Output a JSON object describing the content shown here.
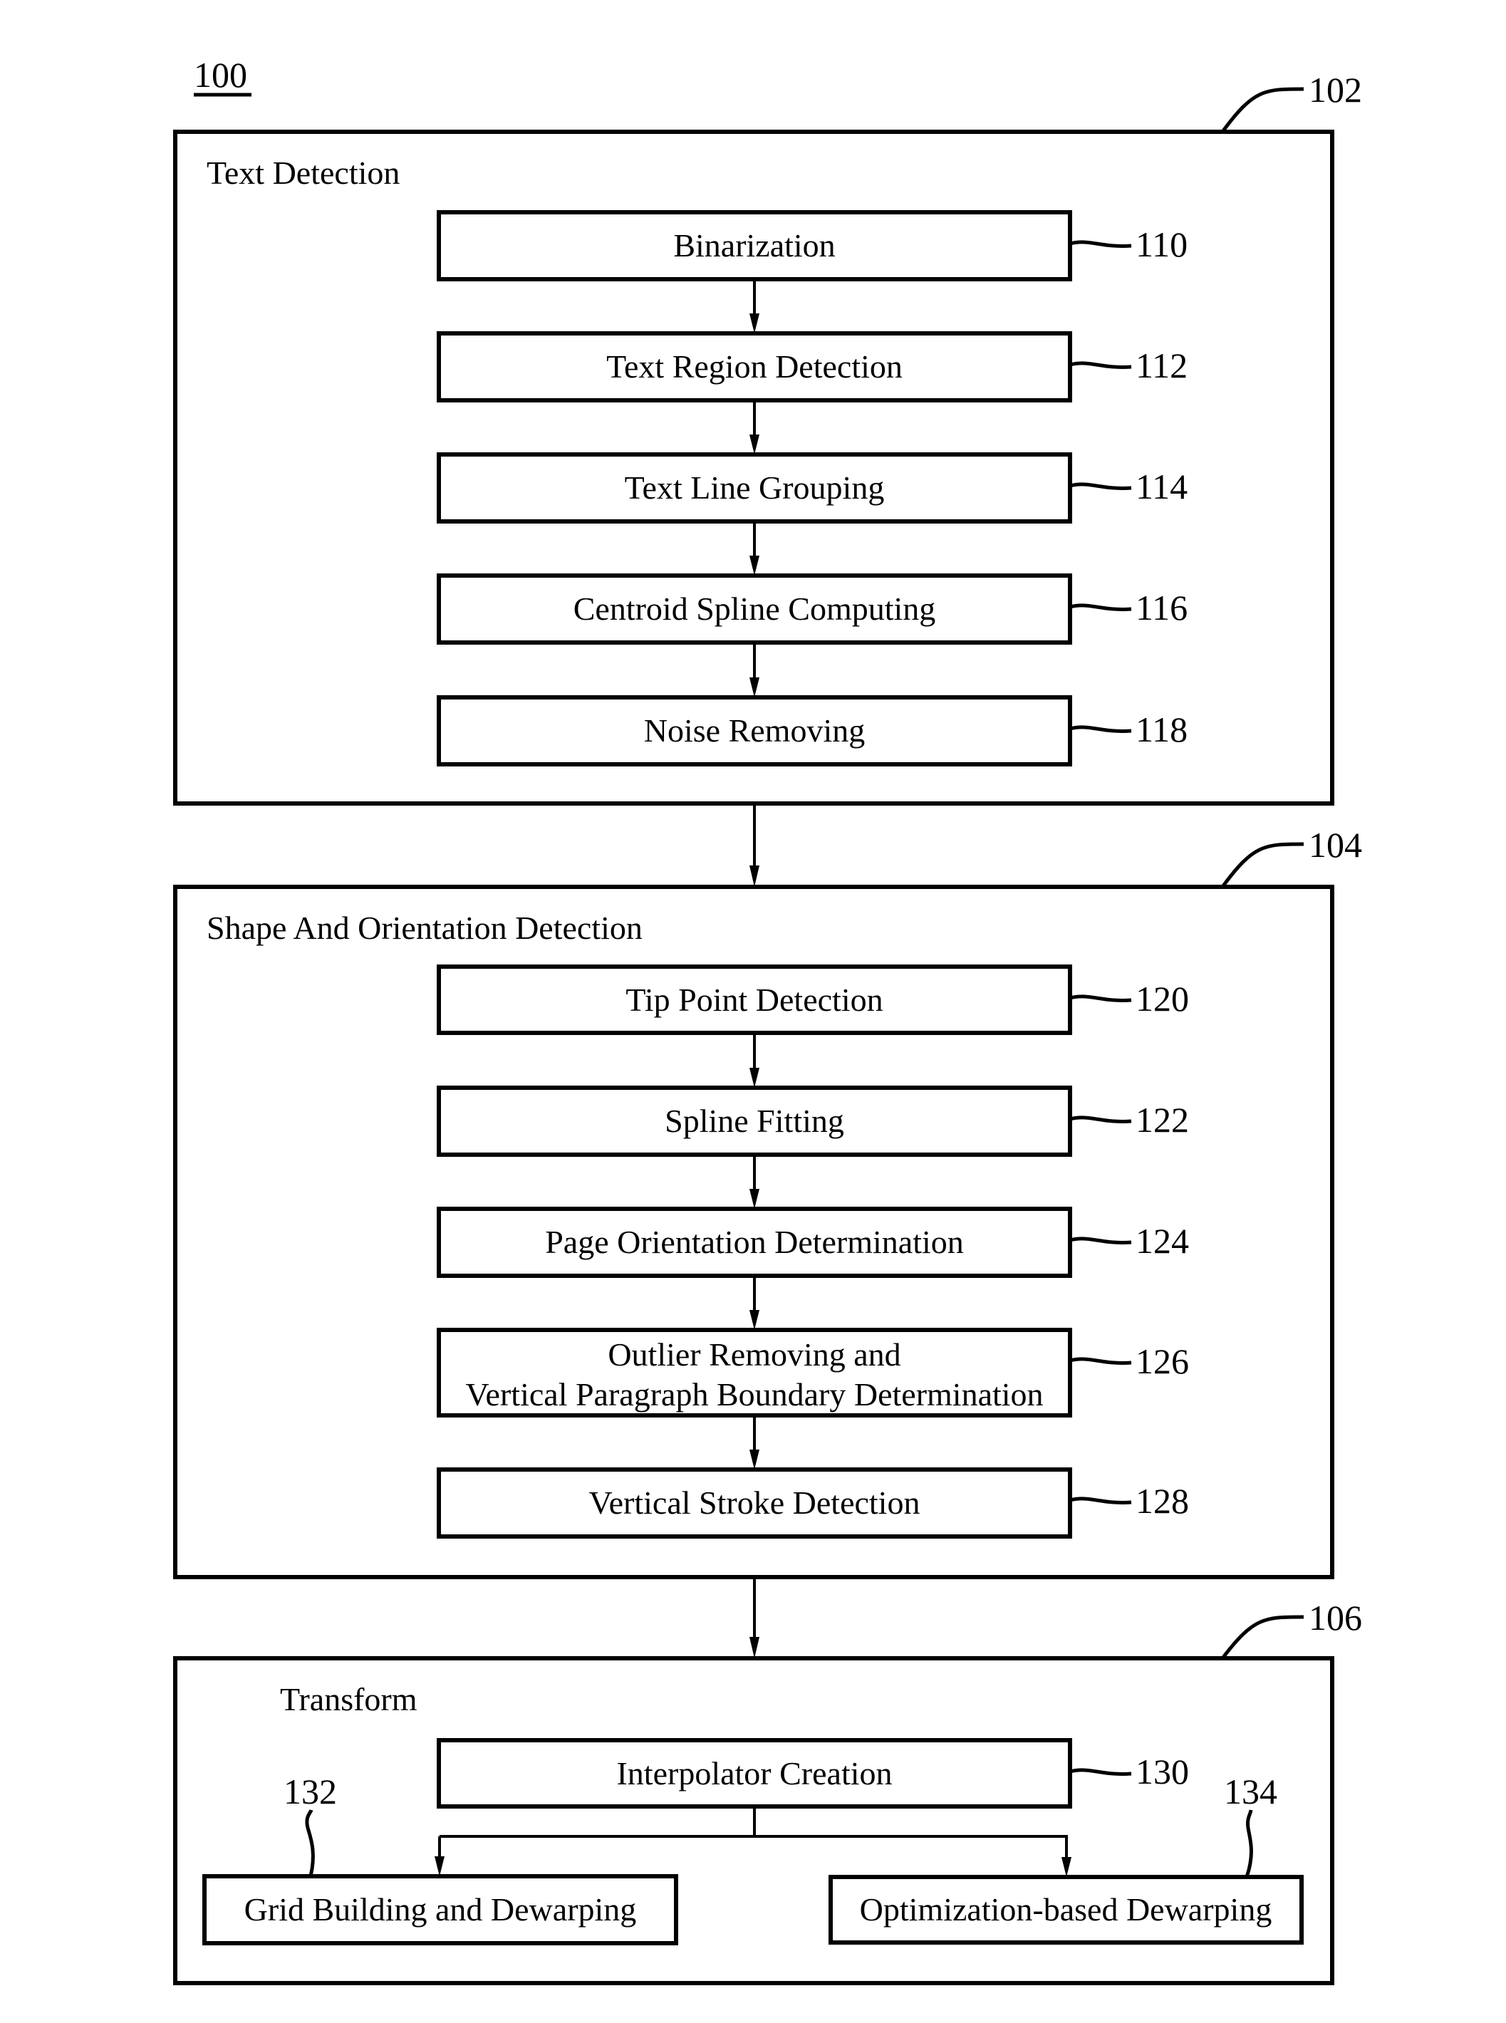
{
  "figure": {
    "ref": "100",
    "sections": [
      {
        "ref": "102",
        "title": "Text Detection",
        "steps": [
          {
            "ref": "110",
            "label": [
              "Binarization"
            ]
          },
          {
            "ref": "112",
            "label": [
              "Text Region Detection"
            ]
          },
          {
            "ref": "114",
            "label": [
              "Text Line Grouping"
            ]
          },
          {
            "ref": "116",
            "label": [
              "Centroid Spline Computing"
            ]
          },
          {
            "ref": "118",
            "label": [
              "Noise Removing"
            ]
          }
        ]
      },
      {
        "ref": "104",
        "title": "Shape And Orientation Detection",
        "steps": [
          {
            "ref": "120",
            "label": [
              "Tip Point Detection"
            ]
          },
          {
            "ref": "122",
            "label": [
              "Spline Fitting"
            ]
          },
          {
            "ref": "124",
            "label": [
              "Page Orientation Determination"
            ]
          },
          {
            "ref": "126",
            "label": [
              "Outlier Removing and",
              "Vertical Paragraph Boundary Determination"
            ]
          },
          {
            "ref": "128",
            "label": [
              "Vertical Stroke Detection"
            ]
          }
        ]
      },
      {
        "ref": "106",
        "title": "Transform",
        "steps": [
          {
            "ref": "130",
            "label": [
              "Interpolator Creation"
            ]
          }
        ],
        "branches": [
          {
            "ref": "132",
            "label": "Grid Building and Dewarping"
          },
          {
            "ref": "134",
            "label": "Optimization-based Dewarping"
          }
        ]
      }
    ]
  }
}
